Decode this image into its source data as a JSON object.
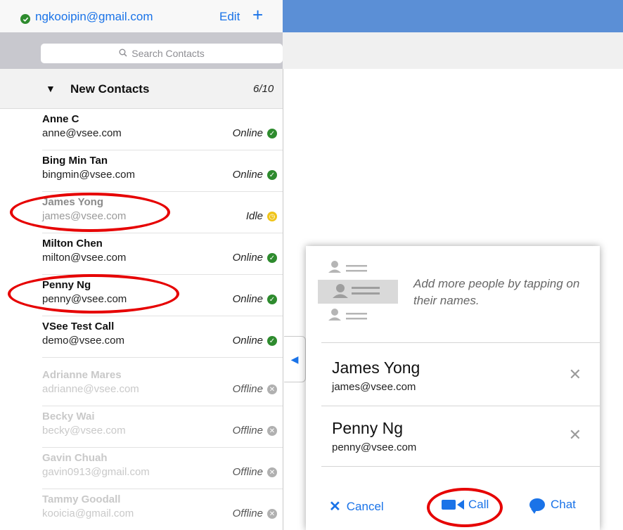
{
  "account": {
    "email": "ngkooipin@gmail.com",
    "edit_label": "Edit",
    "add_label": "+"
  },
  "search": {
    "placeholder": "Search Contacts"
  },
  "group": {
    "title": "New Contacts",
    "count": "6/10"
  },
  "contacts": [
    {
      "name": "Anne C",
      "email": "anne@vsee.com",
      "status": "Online"
    },
    {
      "name": "Bing Min Tan",
      "email": "bingmin@vsee.com",
      "status": "Online"
    },
    {
      "name": "James Yong",
      "email": "james@vsee.com",
      "status": "Idle"
    },
    {
      "name": "Milton Chen",
      "email": "milton@vsee.com",
      "status": "Online"
    },
    {
      "name": "Penny Ng",
      "email": "penny@vsee.com",
      "status": "Online"
    },
    {
      "name": "VSee Test Call",
      "email": "demo@vsee.com",
      "status": "Online"
    },
    {
      "name": "Adrianne Mares",
      "email": "adrianne@vsee.com",
      "status": "Offline"
    },
    {
      "name": "Becky Wai",
      "email": "becky@vsee.com",
      "status": "Offline"
    },
    {
      "name": "Gavin Chuah",
      "email": "gavin0913@gmail.com",
      "status": "Offline"
    },
    {
      "name": "Tammy Goodall",
      "email": "kooicia@gmail.com",
      "status": "Offline"
    }
  ],
  "popover": {
    "hint": "Add more people by tapping on their names.",
    "selected": [
      {
        "name": "James Yong",
        "email": "james@vsee.com"
      },
      {
        "name": "Penny Ng",
        "email": "penny@vsee.com"
      }
    ],
    "actions": {
      "cancel": "Cancel",
      "call": "Call",
      "chat": "Chat"
    }
  },
  "colors": {
    "accent": "#1a73e8",
    "header_blue": "#5b8fd6",
    "online": "#2e8b2e",
    "idle": "#f0c419",
    "offline": "#b0b0b0",
    "annotation_red": "#e60000"
  },
  "icons": {
    "online": "check-circle-icon",
    "idle": "clock-icon",
    "offline": "x-circle-icon"
  }
}
